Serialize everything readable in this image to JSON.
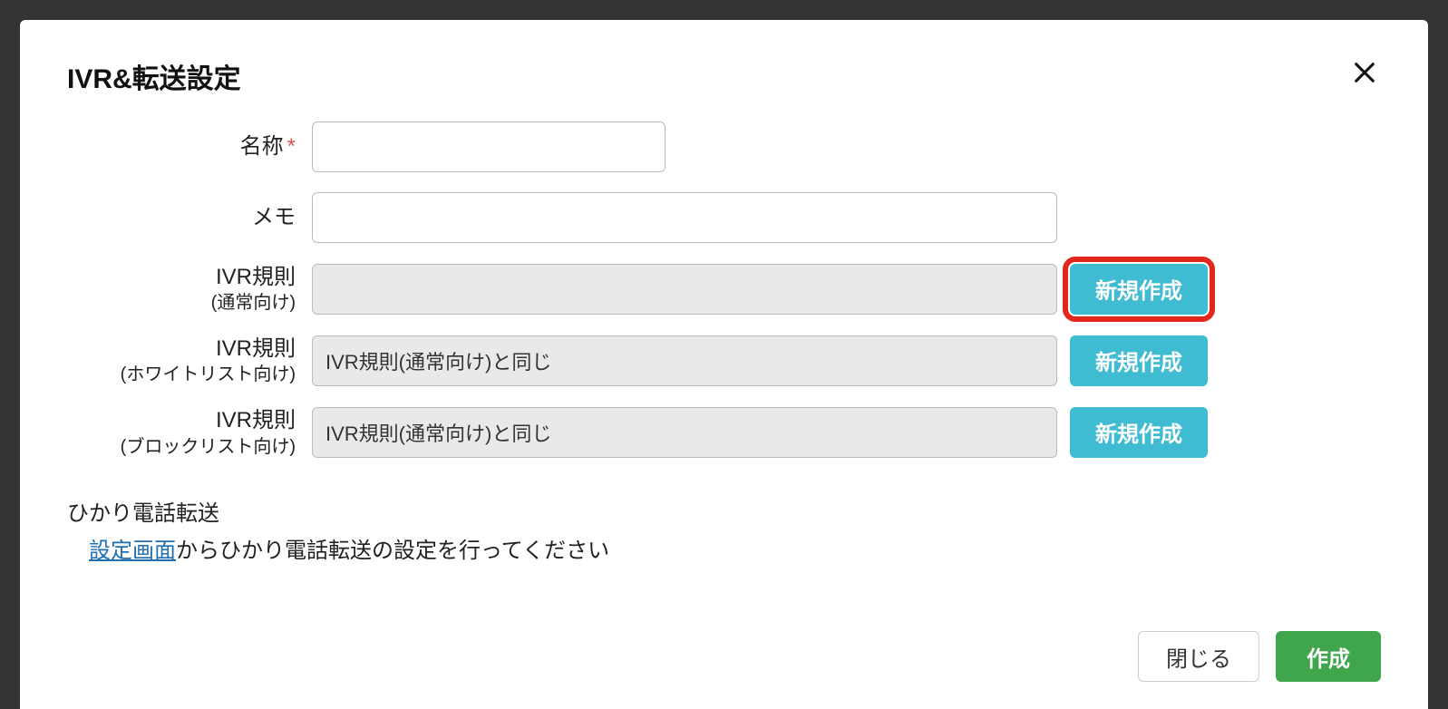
{
  "modal": {
    "title": "IVR&転送設定",
    "fields": {
      "name": {
        "label": "名称",
        "required": true,
        "value": ""
      },
      "memo": {
        "label": "メモ",
        "value": ""
      },
      "ivr_normal": {
        "label": "IVR規則",
        "sublabel": "(通常向け)",
        "value": "",
        "create_button": "新規作成"
      },
      "ivr_whitelist": {
        "label": "IVR規則",
        "sublabel": "(ホワイトリスト向け)",
        "value": "IVR規則(通常向け)と同じ",
        "create_button": "新規作成"
      },
      "ivr_blocklist": {
        "label": "IVR規則",
        "sublabel": "(ブロックリスト向け)",
        "value": "IVR規則(通常向け)と同じ",
        "create_button": "新規作成"
      }
    },
    "hikari": {
      "title": "ひかり電話転送",
      "link_text": "設定画面",
      "desc_suffix": "からひかり電話転送の設定を行ってください"
    },
    "footer": {
      "close": "閉じる",
      "submit": "作成"
    }
  }
}
